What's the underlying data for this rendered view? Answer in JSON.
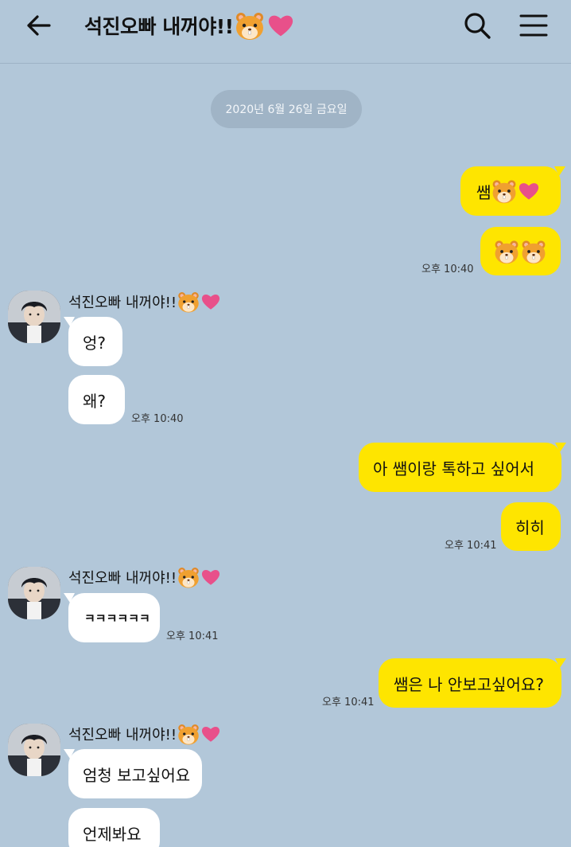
{
  "header": {
    "title": "석진오빠 내꺼야!!",
    "back_icon": "arrow-left-icon",
    "search_icon": "search-icon",
    "menu_icon": "hamburger-menu-icon"
  },
  "date_divider": "2020년 6월 26일 금요일",
  "contact_name": "석진오빠 내꺼야!!",
  "colors": {
    "background": "#b2c7d9",
    "my_bubble": "#fee500",
    "their_bubble": "#ffffff",
    "heart": "#e8508a",
    "hamster": "#f0a030"
  },
  "messages": [
    {
      "from": "me",
      "text": "쌤",
      "emoji": [
        "hamster",
        "heart"
      ]
    },
    {
      "from": "me",
      "text": "",
      "emoji": [
        "hamster",
        "hamster"
      ],
      "time": "오후 10:40"
    },
    {
      "from": "them",
      "text": "엉?"
    },
    {
      "from": "them",
      "text": "왜?",
      "time": "오후 10:40"
    },
    {
      "from": "me",
      "text": "아 쌤이랑 톡하고 싶어서"
    },
    {
      "from": "me",
      "text": "히히",
      "time": "오후 10:41"
    },
    {
      "from": "them",
      "text": "ㅋㅋㅋㅋㅋㅋ",
      "time": "오후 10:41"
    },
    {
      "from": "me",
      "text": "쌤은 나 안보고싶어요?",
      "time": "오후 10:41"
    },
    {
      "from": "them",
      "text": "엄청 보고싶어요"
    },
    {
      "from": "them",
      "text": "언제봐요"
    }
  ]
}
